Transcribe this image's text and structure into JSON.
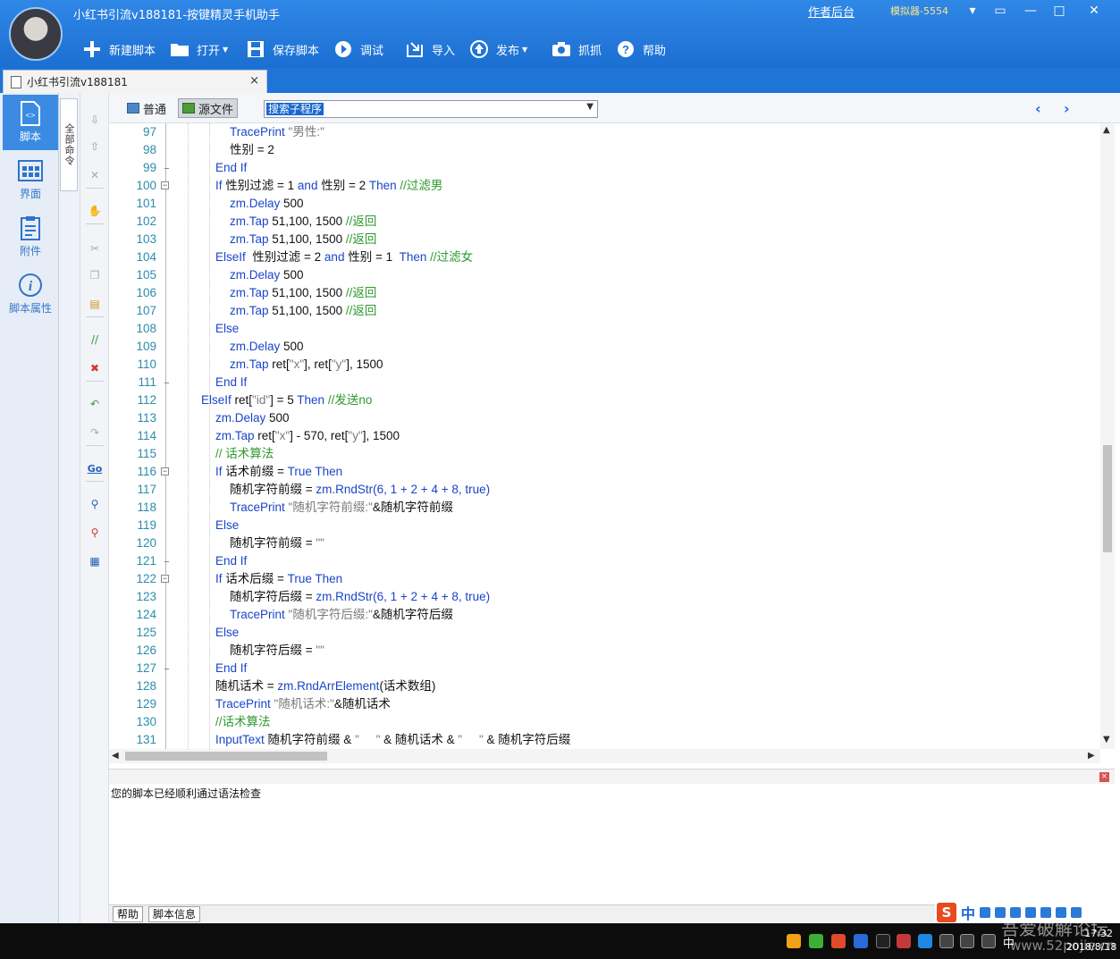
{
  "window": {
    "title": "小红书引流v188181-按键精灵手机助手",
    "author_link": "作者后台",
    "emulator": "模拟器-5554",
    "controls": [
      "▾",
      "▭",
      "—",
      "□",
      "✕"
    ]
  },
  "toolbar": [
    {
      "label": "新建脚本",
      "icon": "plus-icon",
      "caret": false
    },
    {
      "label": "打开",
      "icon": "folder-icon",
      "caret": true
    },
    {
      "label": "保存脚本",
      "icon": "save-icon",
      "caret": false
    },
    {
      "label": "调试",
      "icon": "play-icon",
      "caret": false
    },
    {
      "label": "导入",
      "icon": "import-icon",
      "caret": false
    },
    {
      "label": "发布",
      "icon": "publish-icon",
      "caret": true
    },
    {
      "label": "抓抓",
      "icon": "camera-icon",
      "caret": false
    },
    {
      "label": "帮助",
      "icon": "help-icon",
      "caret": false
    }
  ],
  "doc_tab": {
    "label": "小红书引流v188181",
    "close": "×"
  },
  "leftnav": [
    {
      "label": "脚本",
      "icon": "script-icon",
      "active": true
    },
    {
      "label": "界面",
      "icon": "ui-grid-icon",
      "active": false
    },
    {
      "label": "附件",
      "icon": "attachment-icon",
      "active": false
    },
    {
      "label": "脚本属性",
      "icon": "info-icon",
      "active": false
    }
  ],
  "command_tab": "全部命令",
  "editor_header": {
    "modes": [
      {
        "label": "普通",
        "active": false
      },
      {
        "label": "源文件",
        "active": true
      }
    ],
    "subroutine_search": "搜索子程序",
    "nav_prev": "‹",
    "nav_next": "›"
  },
  "code_lines": [
    {
      "n": "97",
      "indent": 2,
      "fold": "",
      "tokens": [
        [
          "kw",
          "TracePrint "
        ],
        [
          "str",
          "\"男性:\""
        ]
      ]
    },
    {
      "n": "98",
      "indent": 2,
      "fold": "",
      "tokens": [
        [
          "plain",
          "性别 = 2"
        ]
      ]
    },
    {
      "n": "99",
      "indent": 1,
      "fold": "end",
      "tokens": [
        [
          "kw",
          "End If"
        ]
      ]
    },
    {
      "n": "100",
      "indent": 1,
      "fold": "start",
      "tokens": [
        [
          "kw",
          "If "
        ],
        [
          "plain",
          "性别过滤 = 1 "
        ],
        [
          "kw",
          "and "
        ],
        [
          "plain",
          "性别 = 2 "
        ],
        [
          "kw",
          "Then "
        ],
        [
          "cmt",
          "//过滤男"
        ]
      ]
    },
    {
      "n": "101",
      "indent": 2,
      "fold": "",
      "tokens": [
        [
          "kw",
          "zm.Delay "
        ],
        [
          "plain",
          "500"
        ]
      ]
    },
    {
      "n": "102",
      "indent": 2,
      "fold": "",
      "tokens": [
        [
          "kw",
          "zm.Tap "
        ],
        [
          "plain",
          "51,100, 1500 "
        ],
        [
          "cmt",
          "//返回"
        ]
      ]
    },
    {
      "n": "103",
      "indent": 2,
      "fold": "",
      "tokens": [
        [
          "kw",
          "zm.Tap "
        ],
        [
          "plain",
          "51,100, 1500 "
        ],
        [
          "cmt",
          "//返回"
        ]
      ]
    },
    {
      "n": "104",
      "indent": 1,
      "fold": "",
      "tokens": [
        [
          "kw",
          "ElseIf "
        ],
        [
          "plain",
          " 性别过滤 = 2 "
        ],
        [
          "kw",
          "and "
        ],
        [
          "plain",
          "性别 = 1  "
        ],
        [
          "kw",
          "Then "
        ],
        [
          "cmt",
          "//过滤女"
        ]
      ]
    },
    {
      "n": "105",
      "indent": 2,
      "fold": "",
      "tokens": [
        [
          "kw",
          "zm.Delay "
        ],
        [
          "plain",
          "500"
        ]
      ]
    },
    {
      "n": "106",
      "indent": 2,
      "fold": "",
      "tokens": [
        [
          "kw",
          "zm.Tap "
        ],
        [
          "plain",
          "51,100, 1500 "
        ],
        [
          "cmt",
          "//返回"
        ]
      ]
    },
    {
      "n": "107",
      "indent": 2,
      "fold": "",
      "tokens": [
        [
          "kw",
          "zm.Tap "
        ],
        [
          "plain",
          "51,100, 1500 "
        ],
        [
          "cmt",
          "//返回"
        ]
      ]
    },
    {
      "n": "108",
      "indent": 1,
      "fold": "",
      "tokens": [
        [
          "kw",
          "Else"
        ]
      ]
    },
    {
      "n": "109",
      "indent": 2,
      "fold": "",
      "tokens": [
        [
          "kw",
          "zm.Delay "
        ],
        [
          "plain",
          "500"
        ]
      ]
    },
    {
      "n": "110",
      "indent": 2,
      "fold": "",
      "tokens": [
        [
          "kw",
          "zm.Tap "
        ],
        [
          "plain",
          "ret["
        ],
        [
          "str",
          "\"x\""
        ],
        [
          "plain",
          "], ret["
        ],
        [
          "str",
          "\"y\""
        ],
        [
          "plain",
          "], 1500"
        ]
      ]
    },
    {
      "n": "111",
      "indent": 1,
      "fold": "end",
      "tokens": [
        [
          "kw",
          "End If"
        ]
      ]
    },
    {
      "n": "112",
      "indent": 0,
      "fold": "",
      "tokens": [
        [
          "kw",
          "ElseIf "
        ],
        [
          "plain",
          "ret["
        ],
        [
          "str",
          "\"id\""
        ],
        [
          "plain",
          "] = 5 "
        ],
        [
          "kw",
          "Then "
        ],
        [
          "cmt",
          "//发送no"
        ]
      ]
    },
    {
      "n": "113",
      "indent": 1,
      "fold": "",
      "tokens": [
        [
          "kw",
          "zm.Delay "
        ],
        [
          "plain",
          "500"
        ]
      ]
    },
    {
      "n": "114",
      "indent": 1,
      "fold": "",
      "tokens": [
        [
          "kw",
          "zm.Tap "
        ],
        [
          "plain",
          "ret["
        ],
        [
          "str",
          "\"x\""
        ],
        [
          "plain",
          "] - 570, ret["
        ],
        [
          "str",
          "\"y\""
        ],
        [
          "plain",
          "], 1500"
        ]
      ]
    },
    {
      "n": "115",
      "indent": 1,
      "fold": "",
      "tokens": [
        [
          "cmt",
          "// 话术算法"
        ]
      ]
    },
    {
      "n": "116",
      "indent": 1,
      "fold": "start",
      "tokens": [
        [
          "kw",
          "If "
        ],
        [
          "plain",
          "话术前缀 = "
        ],
        [
          "kw",
          "True Then"
        ]
      ]
    },
    {
      "n": "117",
      "indent": 2,
      "fold": "",
      "tokens": [
        [
          "plain",
          "随机字符前缀 = "
        ],
        [
          "kw",
          "zm.RndStr(6, 1 + 2 + 4 + 8, true)"
        ]
      ]
    },
    {
      "n": "118",
      "indent": 2,
      "fold": "",
      "tokens": [
        [
          "kw",
          "TracePrint "
        ],
        [
          "str",
          "\"随机字符前缀:\""
        ],
        [
          "plain",
          "&随机字符前缀"
        ]
      ]
    },
    {
      "n": "119",
      "indent": 1,
      "fold": "",
      "tokens": [
        [
          "kw",
          "Else"
        ]
      ]
    },
    {
      "n": "120",
      "indent": 2,
      "fold": "",
      "tokens": [
        [
          "plain",
          "随机字符前缀 = "
        ],
        [
          "str",
          "\"\""
        ]
      ]
    },
    {
      "n": "121",
      "indent": 1,
      "fold": "end",
      "tokens": [
        [
          "kw",
          "End If"
        ]
      ]
    },
    {
      "n": "122",
      "indent": 1,
      "fold": "start",
      "tokens": [
        [
          "kw",
          "If "
        ],
        [
          "plain",
          "话术后缀 = "
        ],
        [
          "kw",
          "True Then"
        ]
      ]
    },
    {
      "n": "123",
      "indent": 2,
      "fold": "",
      "tokens": [
        [
          "plain",
          "随机字符后缀 = "
        ],
        [
          "kw",
          "zm.RndStr(6, 1 + 2 + 4 + 8, true)"
        ]
      ]
    },
    {
      "n": "124",
      "indent": 2,
      "fold": "",
      "tokens": [
        [
          "kw",
          "TracePrint "
        ],
        [
          "str",
          "\"随机字符后缀:\""
        ],
        [
          "plain",
          "&随机字符后缀"
        ]
      ]
    },
    {
      "n": "125",
      "indent": 1,
      "fold": "",
      "tokens": [
        [
          "kw",
          "Else"
        ]
      ]
    },
    {
      "n": "126",
      "indent": 2,
      "fold": "",
      "tokens": [
        [
          "plain",
          "随机字符后缀 = "
        ],
        [
          "str",
          "\"\""
        ]
      ]
    },
    {
      "n": "127",
      "indent": 1,
      "fold": "end",
      "tokens": [
        [
          "kw",
          "End If"
        ]
      ]
    },
    {
      "n": "128",
      "indent": 1,
      "fold": "",
      "tokens": [
        [
          "plain",
          "随机话术 = "
        ],
        [
          "kw",
          "zm.RndArrElement"
        ],
        [
          "plain",
          "(话术数组)"
        ]
      ]
    },
    {
      "n": "129",
      "indent": 1,
      "fold": "",
      "tokens": [
        [
          "kw",
          "TracePrint "
        ],
        [
          "str",
          "\"随机话术:\""
        ],
        [
          "plain",
          "&随机话术"
        ]
      ]
    },
    {
      "n": "130",
      "indent": 1,
      "fold": "",
      "tokens": [
        [
          "cmt",
          "//话术算法"
        ]
      ]
    },
    {
      "n": "131",
      "indent": 1,
      "fold": "",
      "tokens": [
        [
          "kw",
          "InputText "
        ],
        [
          "plain",
          "随机字符前缀 & "
        ],
        [
          "str",
          "\"     \""
        ],
        [
          "plain",
          " & 随机话术 & "
        ],
        [
          "str",
          "\"     \""
        ],
        [
          "plain",
          " & 随机字符后缀"
        ]
      ]
    }
  ],
  "output": {
    "message": "您的脚本已经顺利通过语法检查"
  },
  "bottom_tabs": [
    "帮助",
    "脚本信息"
  ],
  "ime": {
    "logo": "S",
    "mode": "中"
  },
  "taskbar": {
    "ime_lang": "中",
    "time": "17:32",
    "date": "2018/8/18",
    "watermark_line1": "吾爱破解论坛",
    "watermark_line2": "www.52pojie.cn"
  },
  "colors": {
    "titlebar": "#1f74d8",
    "keyword": "#1b45c8",
    "comment": "#2f9a2f",
    "string": "#7a7a7a",
    "line_number": "#2b8cad"
  }
}
